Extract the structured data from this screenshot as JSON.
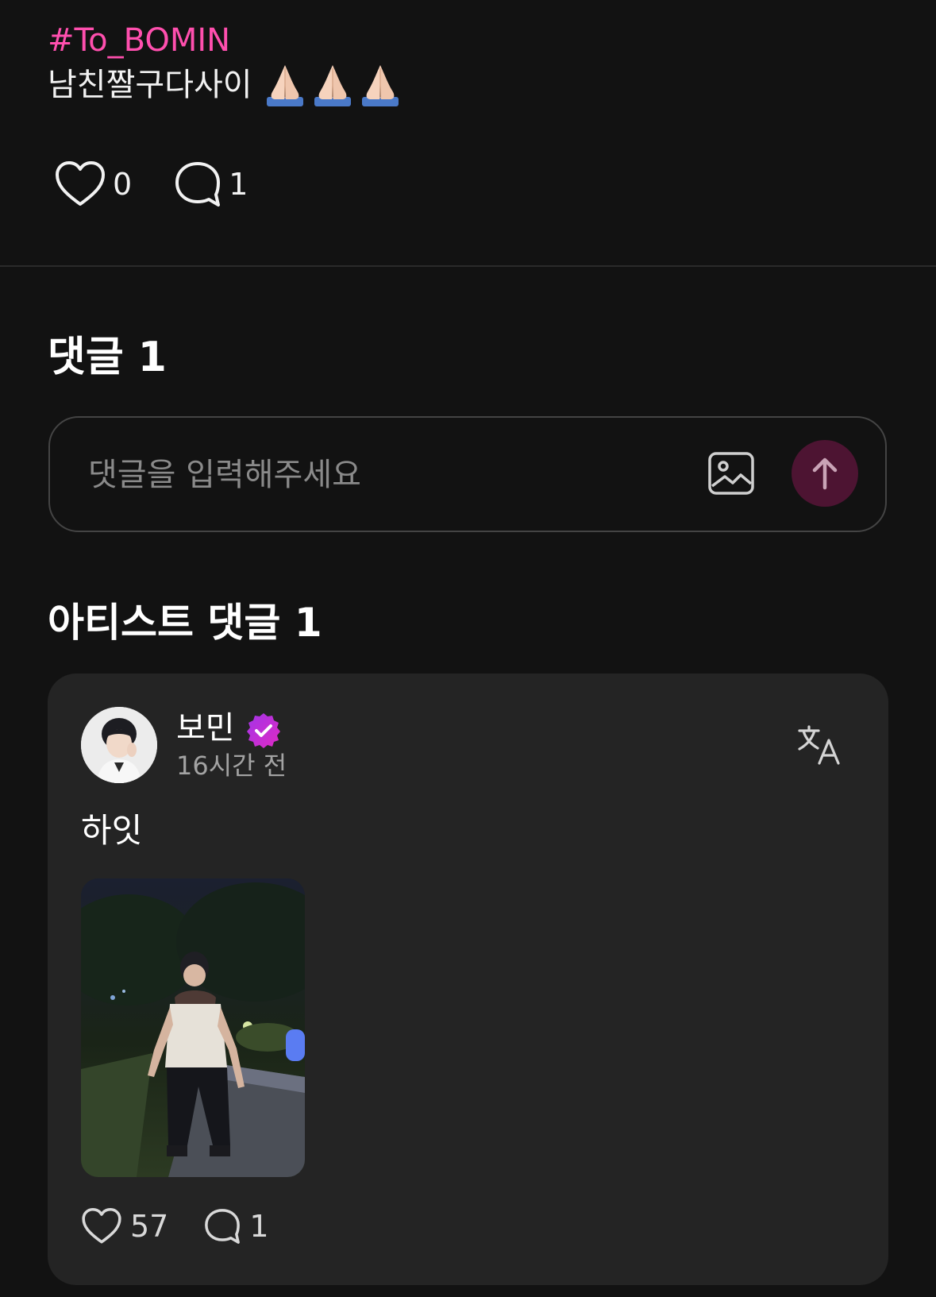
{
  "post": {
    "hashtag": "#To_BOMIN",
    "text": "남친짤구다사이",
    "emojis": [
      "folded-hands-emoji",
      "folded-hands-emoji",
      "folded-hands-emoji"
    ],
    "likes": "0",
    "comments": "1"
  },
  "comments_section": {
    "title": "댓글 1",
    "input_placeholder": "댓글을 입력해주세요",
    "input_value": ""
  },
  "artist_comments": {
    "title": "아티스트 댓글 1",
    "comment": {
      "author": "보민",
      "time": "16시간 전",
      "text": "하잇",
      "likes": "57",
      "replies": "1"
    }
  },
  "colors": {
    "background": "#121212",
    "hashtag": "#ff4fae",
    "card": "#242424",
    "send_button": "#4d1432",
    "verified_badge": "#c42bd8"
  }
}
